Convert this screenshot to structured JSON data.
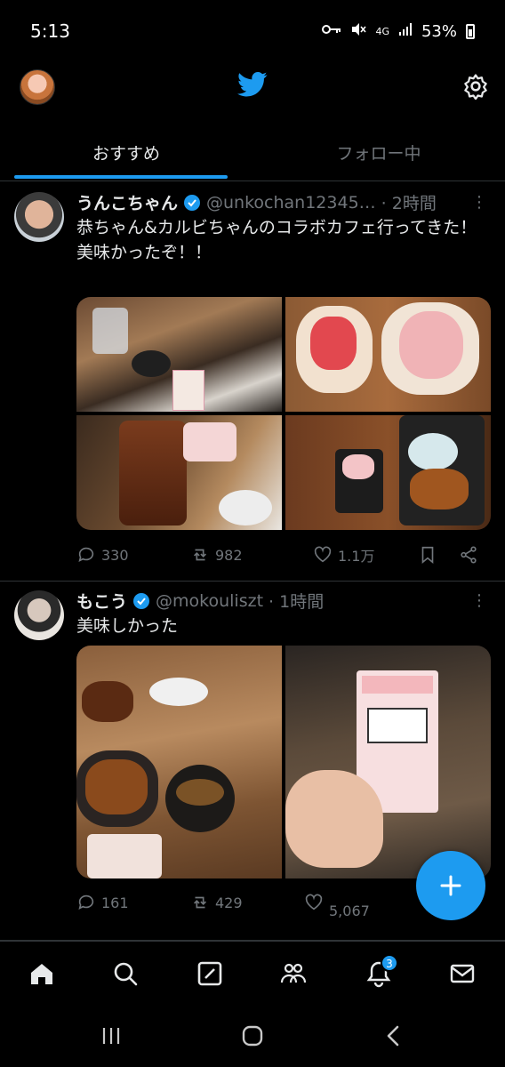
{
  "status_bar": {
    "time": "5:13",
    "network": "4G",
    "battery": "53%",
    "icons": [
      "key-icon",
      "mute-icon",
      "network-4g-icon",
      "signal-icon",
      "battery-icon"
    ]
  },
  "header": {
    "logo": "twitter-bird-icon",
    "settings_icon": "gear-icon"
  },
  "tabs": [
    {
      "label": "おすすめ",
      "active": true
    },
    {
      "label": "フォロー中",
      "active": false
    }
  ],
  "tweets": [
    {
      "name": "うんこちゃん",
      "handle": "@unkochan12345…",
      "time": "· 2時間",
      "text": "恭ちゃん&カルビちゃんのコラボカフェ行ってきた！\n美味かったぞ！！",
      "replies": "330",
      "retweets": "982",
      "likes": "1.1万"
    },
    {
      "name": "もこう",
      "handle": "@mokouliszt",
      "time": "· 1時間",
      "text": "美味しかった",
      "replies": "161",
      "retweets": "429",
      "likes": "5,067"
    }
  ],
  "notifications_badge": "3",
  "colors": {
    "accent": "#1d9bf0",
    "background": "#000000",
    "text": "#e7e9ea",
    "muted": "#71767b"
  }
}
